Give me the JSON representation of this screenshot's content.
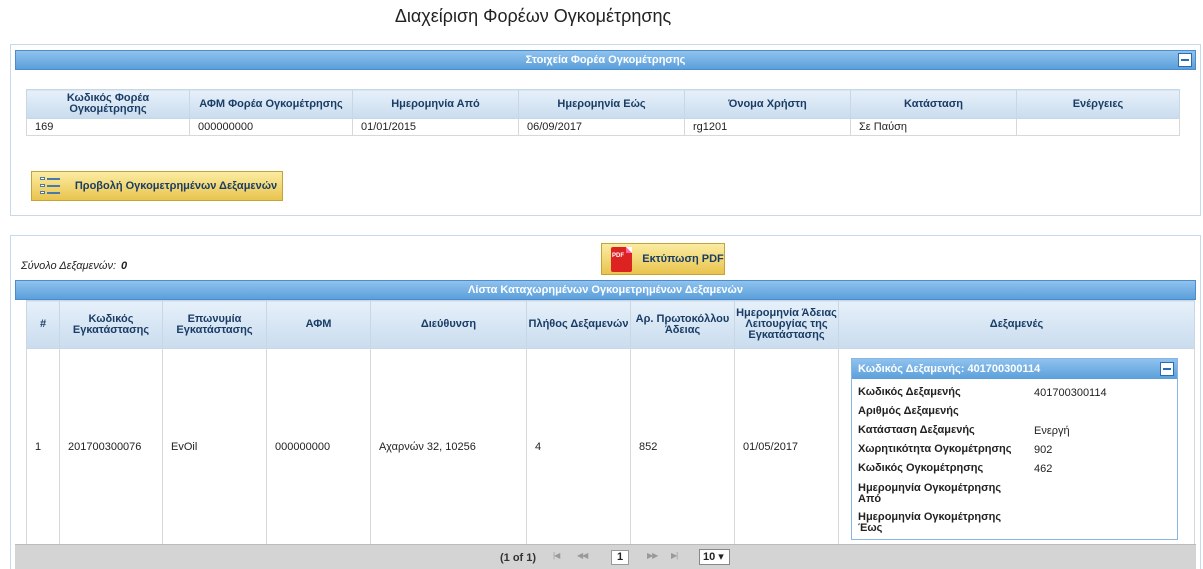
{
  "page_title": "Διαχείριση Φορέων Ογκομέτρησης",
  "carrier_panel": {
    "header": "Στοιχεία Φορέα Ογκομέτρησης",
    "columns": [
      "Κωδικός Φορέα Ογκομέτρησης",
      "ΑΦΜ Φορέα Ογκομέτρησης",
      "Ημερομηνία Από",
      "Ημερομηνία Εώς",
      "Όνομα Χρήστη",
      "Κατάσταση",
      "Ενέργειες"
    ],
    "row": [
      "169",
      "000000000",
      "01/01/2015",
      "06/09/2017",
      "rg1201",
      "Σε Παύση",
      ""
    ],
    "view_button": "Προβολή Ογκομετρημένων Δεξαμενών"
  },
  "tanks_panel": {
    "total_label": "Σύνολο Δεξαμενών:",
    "total_value": "0",
    "print_button": "Εκτύπωση PDF",
    "list_header": "Λίστα Καταχωρημένων Ογκομετρημένων Δεξαμενών",
    "columns": [
      "#",
      "Κωδικός Εγκατάστασης",
      "Επωνυμία Εγκατάστασης",
      "ΑΦΜ",
      "Διεύθυνση",
      "Πλήθος Δεξαμενών",
      "Αρ. Πρωτοκόλλου Άδειας",
      "Ημερομηνία Άδειας Λειτουργίας της Εγκατάστασης",
      "Δεξαμενές"
    ],
    "row": [
      "1",
      "201700300076",
      "EvOil",
      "000000000",
      "Αχαρνών 32, 10256",
      "4",
      "852",
      "01/05/2017"
    ],
    "tank": {
      "header": "Κωδικός Δεξαμενής: 401700300114",
      "fields": [
        {
          "label": "Κωδικός Δεξαμενής",
          "value": "401700300114"
        },
        {
          "label": "Αριθμός Δεξαμενής",
          "value": ""
        },
        {
          "label": "Κατάσταση Δεξαμενής",
          "value": "Ενεργή"
        },
        {
          "label": "Χωρητικότητα Ογκομέτρησης",
          "value": "902"
        },
        {
          "label": "Κωδικός Ογκομέτρησης",
          "value": "462"
        },
        {
          "label": "Ημερομηνία Ογκομέτρησης Από",
          "value": ""
        },
        {
          "label": "Ημερομηνία Ογκομέτρησης Έως",
          "value": ""
        }
      ]
    },
    "pager": {
      "info": "(1 of 1)",
      "first": "|◀",
      "prev": "◀◀",
      "page": "1",
      "next": "▶▶",
      "last": "▶|",
      "rows_per_page": "10 ▾"
    }
  }
}
